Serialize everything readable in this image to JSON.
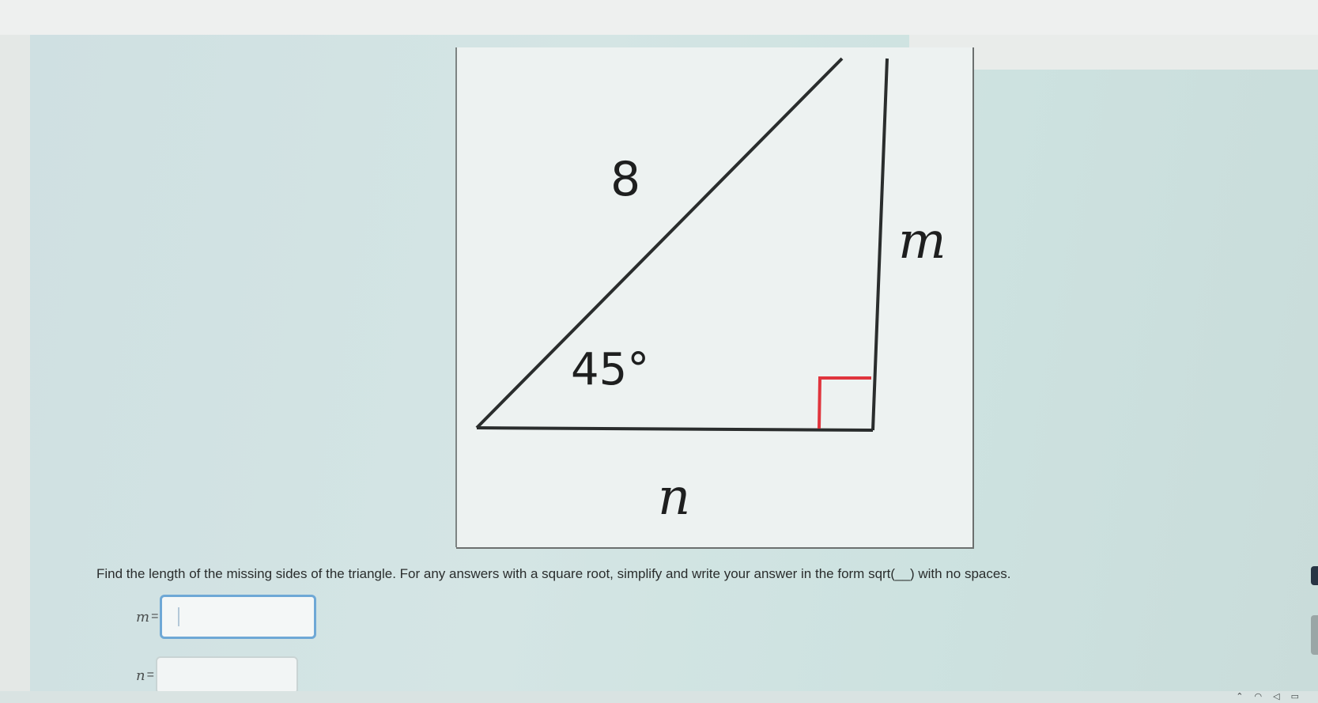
{
  "figure": {
    "hypotenuse_label": "8",
    "angle_label": "45°",
    "vertical_leg_label": "m",
    "horizontal_leg_label": "n",
    "right_angle_marker_color": "#e0353d"
  },
  "question": {
    "instructions": "Find the length of the missing sides of the triangle. For any answers with a square root, simplify and write your answer in the form sqrt(__) with no spaces."
  },
  "answers": [
    {
      "variable": "m",
      "equals": "=",
      "value": "",
      "focused": true
    },
    {
      "variable": "n",
      "equals": "=",
      "value": "",
      "focused": false
    }
  ],
  "taskbar": {
    "tray_icons": [
      "chevron-up-icon",
      "wifi-icon",
      "volume-icon",
      "battery-icon"
    ]
  },
  "colors": {
    "focus_border": "#6ea8d6",
    "page_background": "#d6e3e3",
    "figure_background": "#edf2f1"
  }
}
